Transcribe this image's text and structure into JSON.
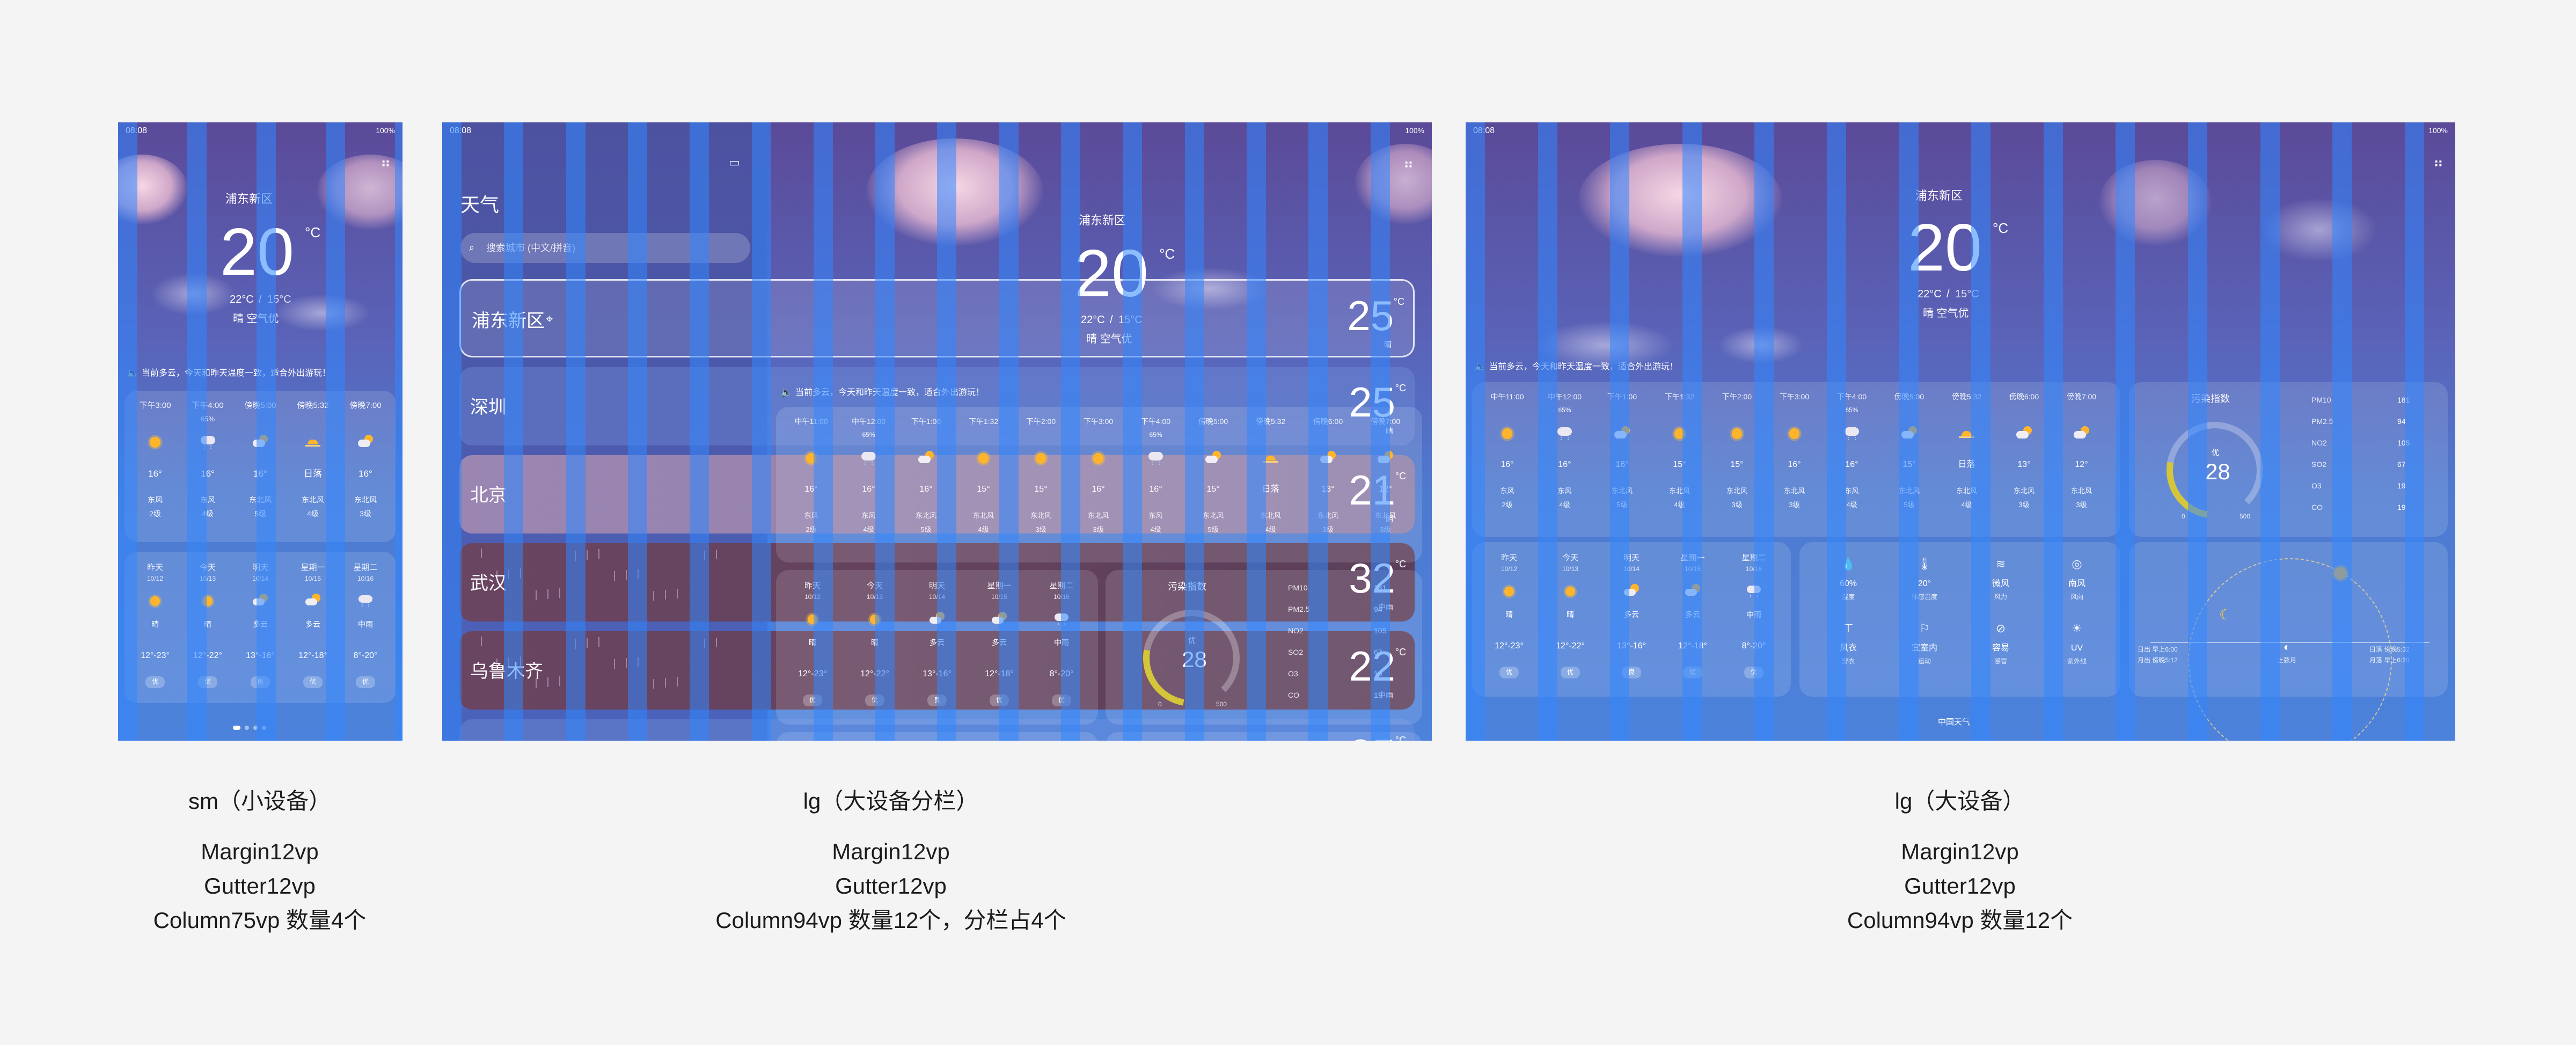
{
  "status": {
    "time": "08:08",
    "battery": "100%"
  },
  "location": "浦东新区",
  "current": {
    "temp": "20",
    "unit": "°C",
    "high": "22°C",
    "low": "15°C",
    "range_sep": " / ",
    "condition": "晴 空气优"
  },
  "notice": "当前多云，今天和昨天温度一致，适合外出游玩！",
  "sidebar": {
    "title": "天气",
    "search_placeholder": "搜索城市 (中文/拼音)",
    "cities": [
      {
        "name": "浦东新区",
        "temp": "25",
        "cond": "晴"
      },
      {
        "name": "深圳",
        "temp": "25",
        "cond": "晴"
      },
      {
        "name": "北京",
        "temp": "21",
        "cond": "阴"
      },
      {
        "name": "武汉",
        "temp": "32",
        "cond": "中雨"
      },
      {
        "name": "乌鲁木齐",
        "temp": "22",
        "cond": "中雨"
      },
      {
        "name": "",
        "temp": "25",
        "cond": ""
      }
    ]
  },
  "hourly": [
    {
      "time": "中午11:00",
      "pct": "",
      "icon": "sun-icon",
      "temp": "16°",
      "wind": "东风",
      "level": "2级"
    },
    {
      "time": "中午12:00",
      "pct": "65%",
      "icon": "rain-cloud-icon",
      "temp": "16°",
      "wind": "东风",
      "level": "4级"
    },
    {
      "time": "下午1:00",
      "pct": "",
      "icon": "partly-cloudy-icon",
      "temp": "16°",
      "wind": "东北风",
      "level": "5级"
    },
    {
      "time": "下午1:32",
      "pct": "",
      "icon": "sun-icon",
      "temp": "15°",
      "wind": "东北风",
      "level": "4级"
    },
    {
      "time": "下午2:00",
      "pct": "",
      "icon": "sun-icon",
      "temp": "15°",
      "wind": "东北风",
      "level": "3级"
    },
    {
      "time": "下午3:00",
      "pct": "",
      "icon": "sun-icon",
      "temp": "16°",
      "wind": "东北风",
      "level": "3级"
    },
    {
      "time": "下午4:00",
      "pct": "65%",
      "icon": "rain-cloud-icon",
      "temp": "16°",
      "wind": "东风",
      "level": "4级"
    },
    {
      "time": "傍晚5:00",
      "pct": "",
      "icon": "partly-cloudy-icon",
      "temp": "15°",
      "wind": "东北风",
      "level": "5级"
    },
    {
      "time": "傍晚5:32",
      "pct": "",
      "icon": "sunset-icon",
      "temp": "日落",
      "wind": "东北风",
      "level": "4级"
    },
    {
      "time": "傍晚6:00",
      "pct": "",
      "icon": "partly-cloudy-icon",
      "temp": "13°",
      "wind": "东北风",
      "level": "3级"
    },
    {
      "time": "傍晚7:00",
      "pct": "",
      "icon": "partly-cloudy-icon",
      "temp": "12°",
      "wind": "东北风",
      "level": "3级"
    }
  ],
  "hourly_sm": [
    {
      "time": "下午3:00",
      "pct": "",
      "temp": "16°",
      "wind": "东风",
      "level": "2级"
    },
    {
      "time": "下午4:00",
      "pct": "65%",
      "temp": "16°",
      "wind": "东风",
      "level": "4级"
    },
    {
      "time": "傍晚5:00",
      "pct": "",
      "temp": "16°",
      "wind": "东北风",
      "level": "5级"
    },
    {
      "time": "傍晚5:32",
      "pct": "",
      "temp": "日落",
      "wind": "东北风",
      "level": "4级"
    },
    {
      "time": "傍晚7:00",
      "pct": "",
      "temp": "16°",
      "wind": "东北风",
      "level": "3级"
    }
  ],
  "daily": [
    {
      "day": "昨天",
      "date": "10/12",
      "cond": "晴",
      "range": "12°-23°",
      "aqi": "优"
    },
    {
      "day": "今天",
      "date": "10/13",
      "cond": "晴",
      "range": "12°-22°",
      "aqi": "优"
    },
    {
      "day": "明天",
      "date": "10/14",
      "cond": "多云",
      "range": "13°-16°",
      "aqi": "良"
    },
    {
      "day": "星期一",
      "date": "10/15",
      "cond": "多云",
      "range": "12°-18°",
      "aqi": "优"
    },
    {
      "day": "星期二",
      "date": "10/16",
      "cond": "中雨",
      "range": "8°-20°",
      "aqi": "优"
    }
  ],
  "aqi": {
    "title": "污染指数",
    "level": "优",
    "value": "28",
    "min": "0",
    "max": "500",
    "items": [
      {
        "name": "PM10",
        "val": "181"
      },
      {
        "name": "PM2.5",
        "val": "94"
      },
      {
        "name": "NO2",
        "val": "105"
      },
      {
        "name": "SO2",
        "val": "67"
      },
      {
        "name": "O3",
        "val": "19"
      },
      {
        "name": "CO",
        "val": "19"
      }
    ]
  },
  "details": [
    {
      "val": "60%",
      "label": "湿度"
    },
    {
      "val": "20°",
      "label": "体感温度"
    },
    {
      "val": "微风",
      "label": "风力"
    },
    {
      "val": "南风",
      "label": "风向"
    },
    {
      "val": "风衣",
      "label": "穿衣"
    },
    {
      "val": "宜室内",
      "label": "运动"
    },
    {
      "val": "容易",
      "label": "感冒"
    },
    {
      "val": "UV",
      "label": "紫外线"
    }
  ],
  "sun": {
    "rise": "日出 早上6:00",
    "moonrise": "月出 傍晚5:12",
    "phase": "上弦月",
    "set": "日落 傍晚5:32",
    "moonset": "月落 早上6:20"
  },
  "footer": "中国天气",
  "captions": [
    {
      "title": "sm（小设备）",
      "margin": "Margin12vp",
      "gutter": "Gutter12vp",
      "column": "Column75vp  数量4个"
    },
    {
      "title": "lg（大设备分栏）",
      "margin": "Margin12vp",
      "gutter": "Gutter12vp",
      "column": "Column94vp  数量12个，分栏占4个"
    },
    {
      "title": "lg（大设备）",
      "margin": "Margin12vp",
      "gutter": "Gutter12vp",
      "column": "Column94vp  数量12个"
    }
  ],
  "colors": {
    "page_bg": "#f4f4f4",
    "grid_column": "#3287ff",
    "sun": "#ffb52b",
    "aqi_gauge": "#d4c53a"
  }
}
